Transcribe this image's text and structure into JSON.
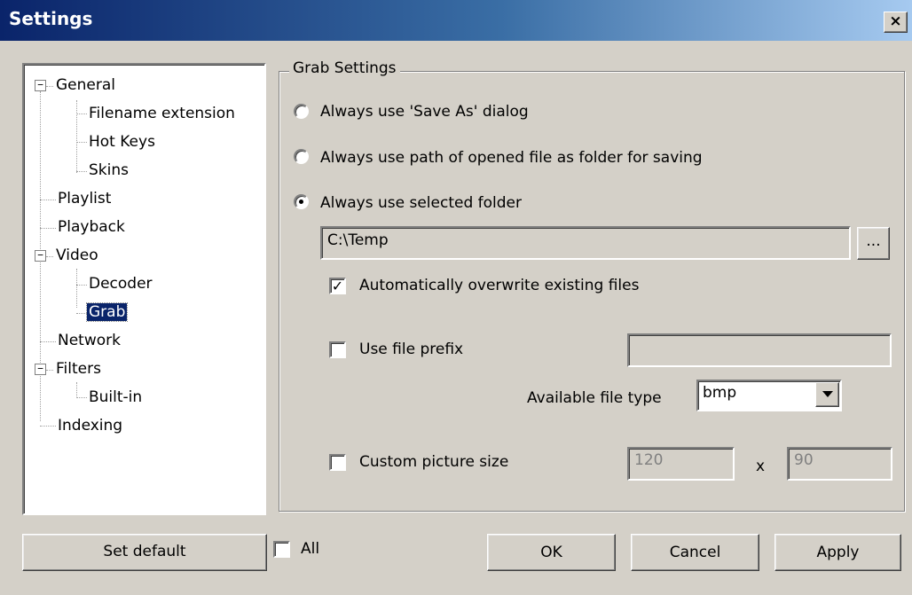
{
  "window": {
    "title": "Settings",
    "close_label": "×"
  },
  "tree": {
    "items": [
      {
        "label": "General",
        "expander": "−"
      },
      {
        "label": "Filename extension"
      },
      {
        "label": "Hot Keys"
      },
      {
        "label": "Skins"
      },
      {
        "label": "Playlist"
      },
      {
        "label": "Playback"
      },
      {
        "label": "Video",
        "expander": "−"
      },
      {
        "label": "Decoder"
      },
      {
        "label": "Grab",
        "selected": true
      },
      {
        "label": "Network"
      },
      {
        "label": "Filters",
        "expander": "−"
      },
      {
        "label": "Built-in"
      },
      {
        "label": "Indexing"
      }
    ]
  },
  "grab": {
    "group_title": "Grab Settings",
    "radio_save_as": "Always use 'Save As' dialog",
    "radio_opened_path": "Always use path of opened file as folder for saving",
    "radio_selected_folder": "Always use selected folder",
    "selected_option": "selected_folder",
    "folder_path": "C:\\Temp",
    "browse_label": "...",
    "overwrite_label": "Automatically overwrite existing files",
    "overwrite_checked": true,
    "check_mark": "✓",
    "prefix_label": "Use file prefix",
    "prefix_checked": false,
    "prefix_value": "",
    "file_type_label": "Available file type",
    "file_type_value": "bmp",
    "custom_size_label": "Custom picture size",
    "custom_size_checked": false,
    "width_value": "120",
    "x_label": "x",
    "height_value": "90"
  },
  "footer": {
    "set_default": "Set default",
    "all_label": "All",
    "all_checked": false,
    "ok": "OK",
    "cancel": "Cancel",
    "apply": "Apply"
  }
}
